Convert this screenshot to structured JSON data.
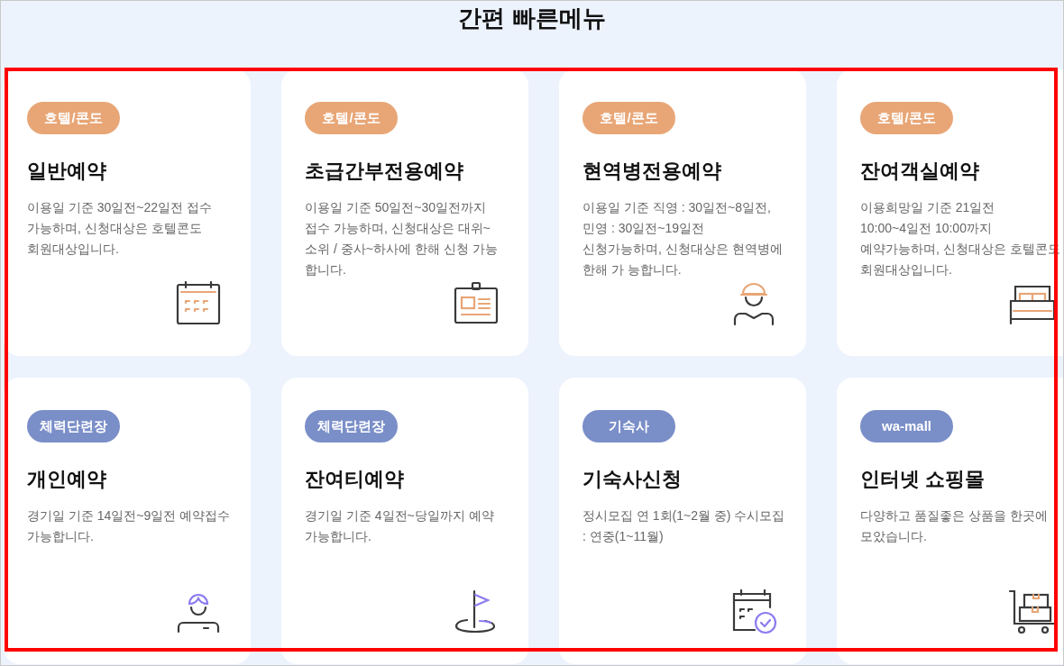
{
  "title": "간편 빠른메뉴",
  "cards": [
    {
      "badge": "호텔/콘도",
      "color": "#e8a676",
      "title": "일반예약",
      "description": "이용일 기준 30일전~22일전 접수 가능하며, 신청대상은 호텔콘도 회원대상입니다."
    },
    {
      "badge": "호텔/콘도",
      "color": "#e8a676",
      "title": "초급간부전용예약",
      "description": "이용일 기준 50일전~30일전까지 접수 가능하며, 신청대상은 대위~ 소위 / 중사~하사에 한해 신청 가능 합니다."
    },
    {
      "badge": "호텔/콘도",
      "color": "#e8a676",
      "title": "현역병전용예약",
      "description": "이용일 기준 직영 : 30일전~8일전, 민영 : 30일전~19일전 신청가능하며, 신청대상은 현역병에 한해 가 능합니다."
    },
    {
      "badge": "호텔/콘도",
      "color": "#e8a676",
      "title": "잔여객실예약",
      "description": "이용희망일 기준 21일전 10:00~4일전 10:00까지 예약가능하며, 신청대상은 호텔콘도 회원대상입니다."
    },
    {
      "badge": "체력단련장",
      "color": "#7a8ec8",
      "title": "개인예약",
      "description": "경기일 기준 14일전~9일전 예약접수 가능합니다."
    },
    {
      "badge": "체력단련장",
      "color": "#7a8ec8",
      "title": "잔여티예약",
      "description": "경기일 기준 4일전~당일까지 예약 가능합니다."
    },
    {
      "badge": "기숙사",
      "color": "#7a8ec8",
      "title": "기숙사신청",
      "description": "정시모집 연 1회(1~2월 중) 수시모집 : 연중(1~11월)"
    },
    {
      "badge": "wa-mall",
      "color": "#7a8ec8",
      "title": "인터넷 쇼핑몰",
      "description": "다양하고 품질좋은 상품을 한곳에 모았습니다."
    }
  ]
}
